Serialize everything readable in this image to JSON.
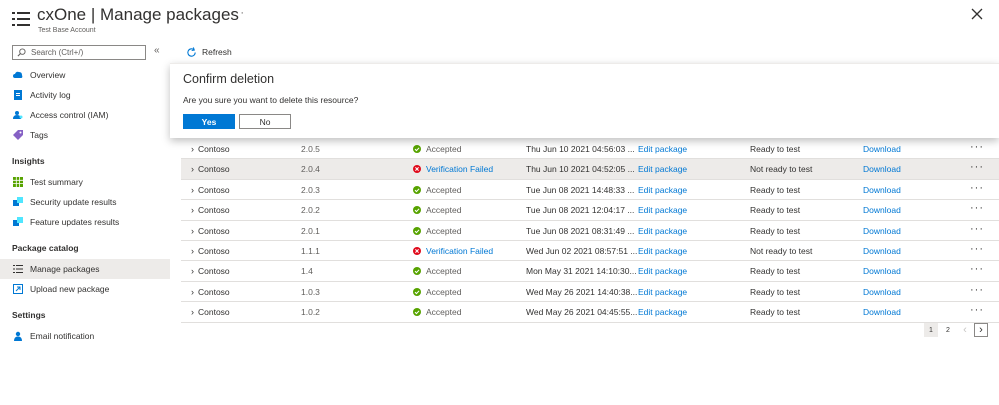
{
  "header": {
    "title": "cxOne | Manage packages",
    "subtitle": "Test Base Account",
    "ellipsis": "···"
  },
  "sidebar": {
    "search_placeholder": "Search (Ctrl+/)",
    "collapse": "«",
    "items_top": [
      {
        "label": "Overview",
        "icon": "cloud-icon"
      },
      {
        "label": "Activity log",
        "icon": "activity-log-icon"
      },
      {
        "label": "Access control (IAM)",
        "icon": "access-control-icon"
      },
      {
        "label": "Tags",
        "icon": "tag-icon"
      }
    ],
    "insights_heading": "Insights",
    "insights": [
      {
        "label": "Test summary",
        "icon": "grid-icon"
      },
      {
        "label": "Security update results",
        "icon": "puzzle-icon"
      },
      {
        "label": "Feature updates results",
        "icon": "puzzle-icon"
      }
    ],
    "catalog_heading": "Package catalog",
    "catalog": [
      {
        "label": "Manage packages",
        "icon": "list-icon",
        "active": true
      },
      {
        "label": "Upload new package",
        "icon": "upload-icon"
      }
    ],
    "settings_heading": "Settings",
    "settings": [
      {
        "label": "Email notification",
        "icon": "person-icon"
      }
    ]
  },
  "toolbar": {
    "refresh_label": "Refresh"
  },
  "dialog": {
    "title": "Confirm deletion",
    "message": "Are you sure you want to delete this resource?",
    "yes_label": "Yes",
    "no_label": "No"
  },
  "table": {
    "rows": [
      {
        "name": "Contoso",
        "version": "2.0.5",
        "status": "Accepted",
        "status_type": "ok",
        "date": "Thu Jun 10 2021 04:56:03 ...",
        "edit": "Edit package",
        "test_state": "Ready to test",
        "download": "Download",
        "more": "···"
      },
      {
        "name": "Contoso",
        "version": "2.0.4",
        "status": "Verification Failed",
        "status_type": "fail",
        "date": "Thu Jun 10 2021 04:52:05 ...",
        "edit": "Edit package",
        "test_state": "Not ready to test",
        "download": "Download",
        "more": "···",
        "highlight": true
      },
      {
        "name": "Contoso",
        "version": "2.0.3",
        "status": "Accepted",
        "status_type": "ok",
        "date": "Tue Jun 08 2021 14:48:33 ...",
        "edit": "Edit package",
        "test_state": "Ready to test",
        "download": "Download",
        "more": "···"
      },
      {
        "name": "Contoso",
        "version": "2.0.2",
        "status": "Accepted",
        "status_type": "ok",
        "date": "Tue Jun 08 2021 12:04:17 ...",
        "edit": "Edit package",
        "test_state": "Ready to test",
        "download": "Download",
        "more": "···"
      },
      {
        "name": "Contoso",
        "version": "2.0.1",
        "status": "Accepted",
        "status_type": "ok",
        "date": "Tue Jun 08 2021 08:31:49 ...",
        "edit": "Edit package",
        "test_state": "Ready to test",
        "download": "Download",
        "more": "···"
      },
      {
        "name": "Contoso",
        "version": "1.1.1",
        "status": "Verification Failed",
        "status_type": "fail",
        "date": "Wed Jun 02 2021 08:57:51 ...",
        "edit": "Edit package",
        "test_state": "Not ready to test",
        "download": "Download",
        "more": "···"
      },
      {
        "name": "Contoso",
        "version": "1.4",
        "status": "Accepted",
        "status_type": "ok",
        "date": "Mon May 31 2021 14:10:30...",
        "edit": "Edit package",
        "test_state": "Ready to test",
        "download": "Download",
        "more": "···"
      },
      {
        "name": "Contoso",
        "version": "1.0.3",
        "status": "Accepted",
        "status_type": "ok",
        "date": "Wed May 26 2021 14:40:38...",
        "edit": "Edit package",
        "test_state": "Ready to test",
        "download": "Download",
        "more": "···"
      },
      {
        "name": "Contoso",
        "version": "1.0.2",
        "status": "Accepted",
        "status_type": "ok",
        "date": "Wed May 26 2021 04:45:55...",
        "edit": "Edit package",
        "test_state": "Ready to test",
        "download": "Download",
        "more": "···"
      }
    ]
  },
  "pagination": {
    "page1": "1",
    "page2": "2",
    "prev": "‹",
    "next": "›"
  },
  "colors": {
    "accent": "#0078d4",
    "success": "#57a300",
    "error": "#e00b1c"
  }
}
